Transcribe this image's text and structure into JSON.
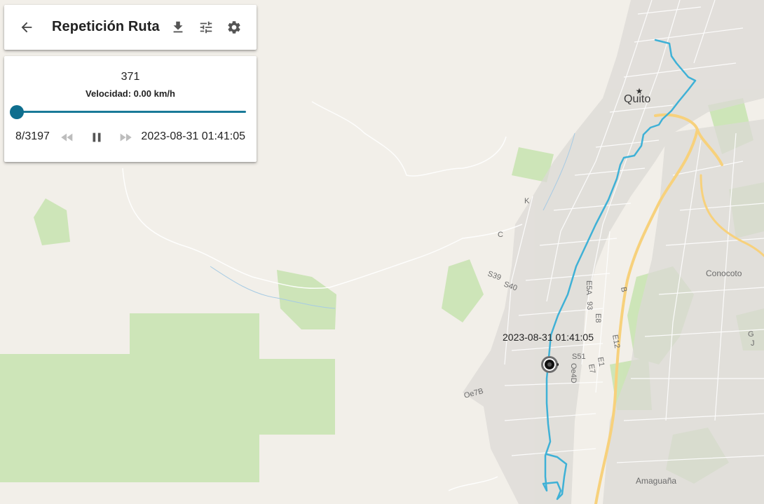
{
  "toolbar": {
    "title": "Repetición Ruta",
    "back_icon": "arrow-back-icon",
    "download_icon": "download-icon",
    "filter_icon": "tune-icon",
    "settings_icon": "gear-icon"
  },
  "player": {
    "speed_value": "371",
    "speed_text": "Velocidad: 0.00 km/h",
    "position": "8/3197",
    "progress_fraction": 0.0025,
    "timestamp": "2023-08-31 01:41:05"
  },
  "map": {
    "marker_label": "2023-08-31 01:41:05",
    "route_color": "#3fb1d6",
    "labels": {
      "quito": "Quito",
      "conocoto": "Conocoto",
      "amaguana": "Amaguaña",
      "s39": "S39",
      "s40": "S40",
      "e5a": "E5A",
      "n93": "93",
      "e8": "E8",
      "e12": "E12",
      "b": "B",
      "s51": "S51",
      "e1": "E1",
      "e7": "E7",
      "oe4d": "Oe4D",
      "oe7b": "Oe7B",
      "k": "K",
      "c": "C",
      "g": "G",
      "j": "J"
    }
  }
}
